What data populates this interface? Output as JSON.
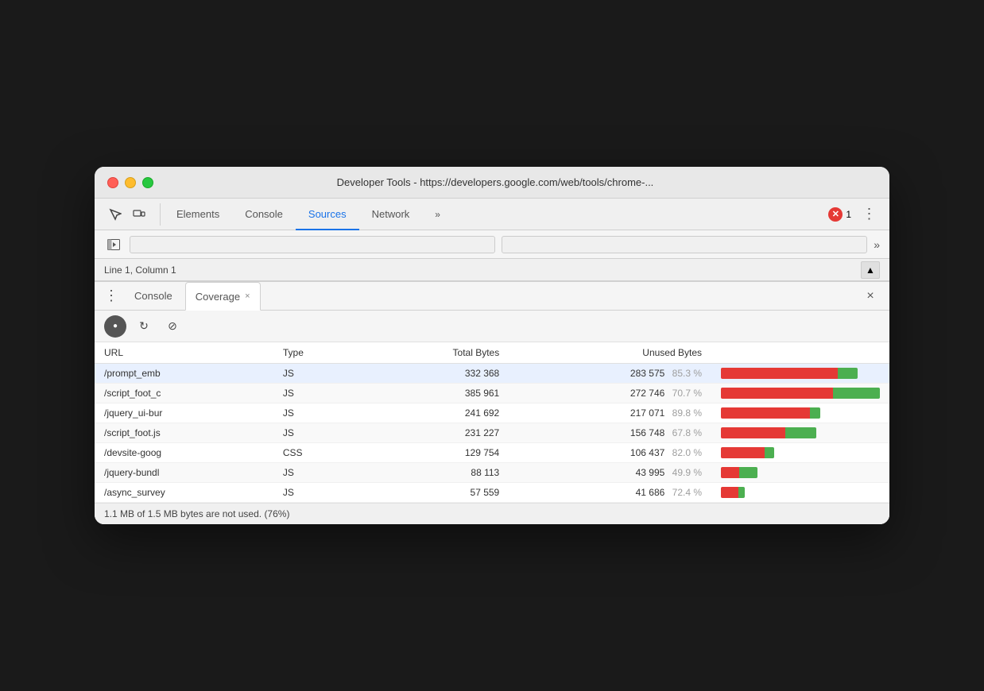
{
  "window": {
    "title": "Developer Tools - https://developers.google.com/web/tools/chrome-...",
    "traffic_lights": [
      "red",
      "yellow",
      "green"
    ]
  },
  "toolbar": {
    "tabs": [
      {
        "id": "elements",
        "label": "Elements",
        "active": false
      },
      {
        "id": "console",
        "label": "Console",
        "active": false
      },
      {
        "id": "sources",
        "label": "Sources",
        "active": true
      },
      {
        "id": "network",
        "label": "Network",
        "active": false
      }
    ],
    "more_label": "»",
    "error_count": "1",
    "menu_label": "⋮"
  },
  "subbar": {
    "status_text": "Line 1, Column 1"
  },
  "drawer": {
    "console_tab": "Console",
    "coverage_tab": "Coverage",
    "close_label": "×"
  },
  "coverage": {
    "record_btn": "●",
    "reload_btn": "↻",
    "clear_btn": "⊘",
    "columns": [
      "URL",
      "Type",
      "Total Bytes",
      "Unused Bytes",
      ""
    ],
    "rows": [
      {
        "url": "/prompt_emb",
        "type": "JS",
        "total_bytes": "332 368",
        "unused_bytes": "283 575",
        "unused_pct": "85.3 %",
        "unused_ratio": 85.3,
        "total_ratio": 100
      },
      {
        "url": "/script_foot_c",
        "type": "JS",
        "total_bytes": "385 961",
        "unused_bytes": "272 746",
        "unused_pct": "70.7 %",
        "unused_ratio": 70.7,
        "total_ratio": 100
      },
      {
        "url": "/jquery_ui-bur",
        "type": "JS",
        "total_bytes": "241 692",
        "unused_bytes": "217 071",
        "unused_pct": "89.8 %",
        "unused_ratio": 89.8,
        "total_ratio": 60
      },
      {
        "url": "/script_foot.js",
        "type": "JS",
        "total_bytes": "231 227",
        "unused_bytes": "156 748",
        "unused_pct": "67.8 %",
        "unused_ratio": 67.8,
        "total_ratio": 55
      },
      {
        "url": "/devsite-goog",
        "type": "CSS",
        "total_bytes": "129 754",
        "unused_bytes": "106 437",
        "unused_pct": "82.0 %",
        "unused_ratio": 82.0,
        "total_ratio": 38
      },
      {
        "url": "/jquery-bundl",
        "type": "JS",
        "total_bytes": "88 113",
        "unused_bytes": "43 995",
        "unused_pct": "49.9 %",
        "unused_ratio": 49.9,
        "total_ratio": 24
      },
      {
        "url": "/async_survey",
        "type": "JS",
        "total_bytes": "57 559",
        "unused_bytes": "41 686",
        "unused_pct": "72.4 %",
        "unused_ratio": 72.4,
        "total_ratio": 18
      }
    ],
    "footer": "1.1 MB of 1.5 MB bytes are not used. (76%)"
  }
}
